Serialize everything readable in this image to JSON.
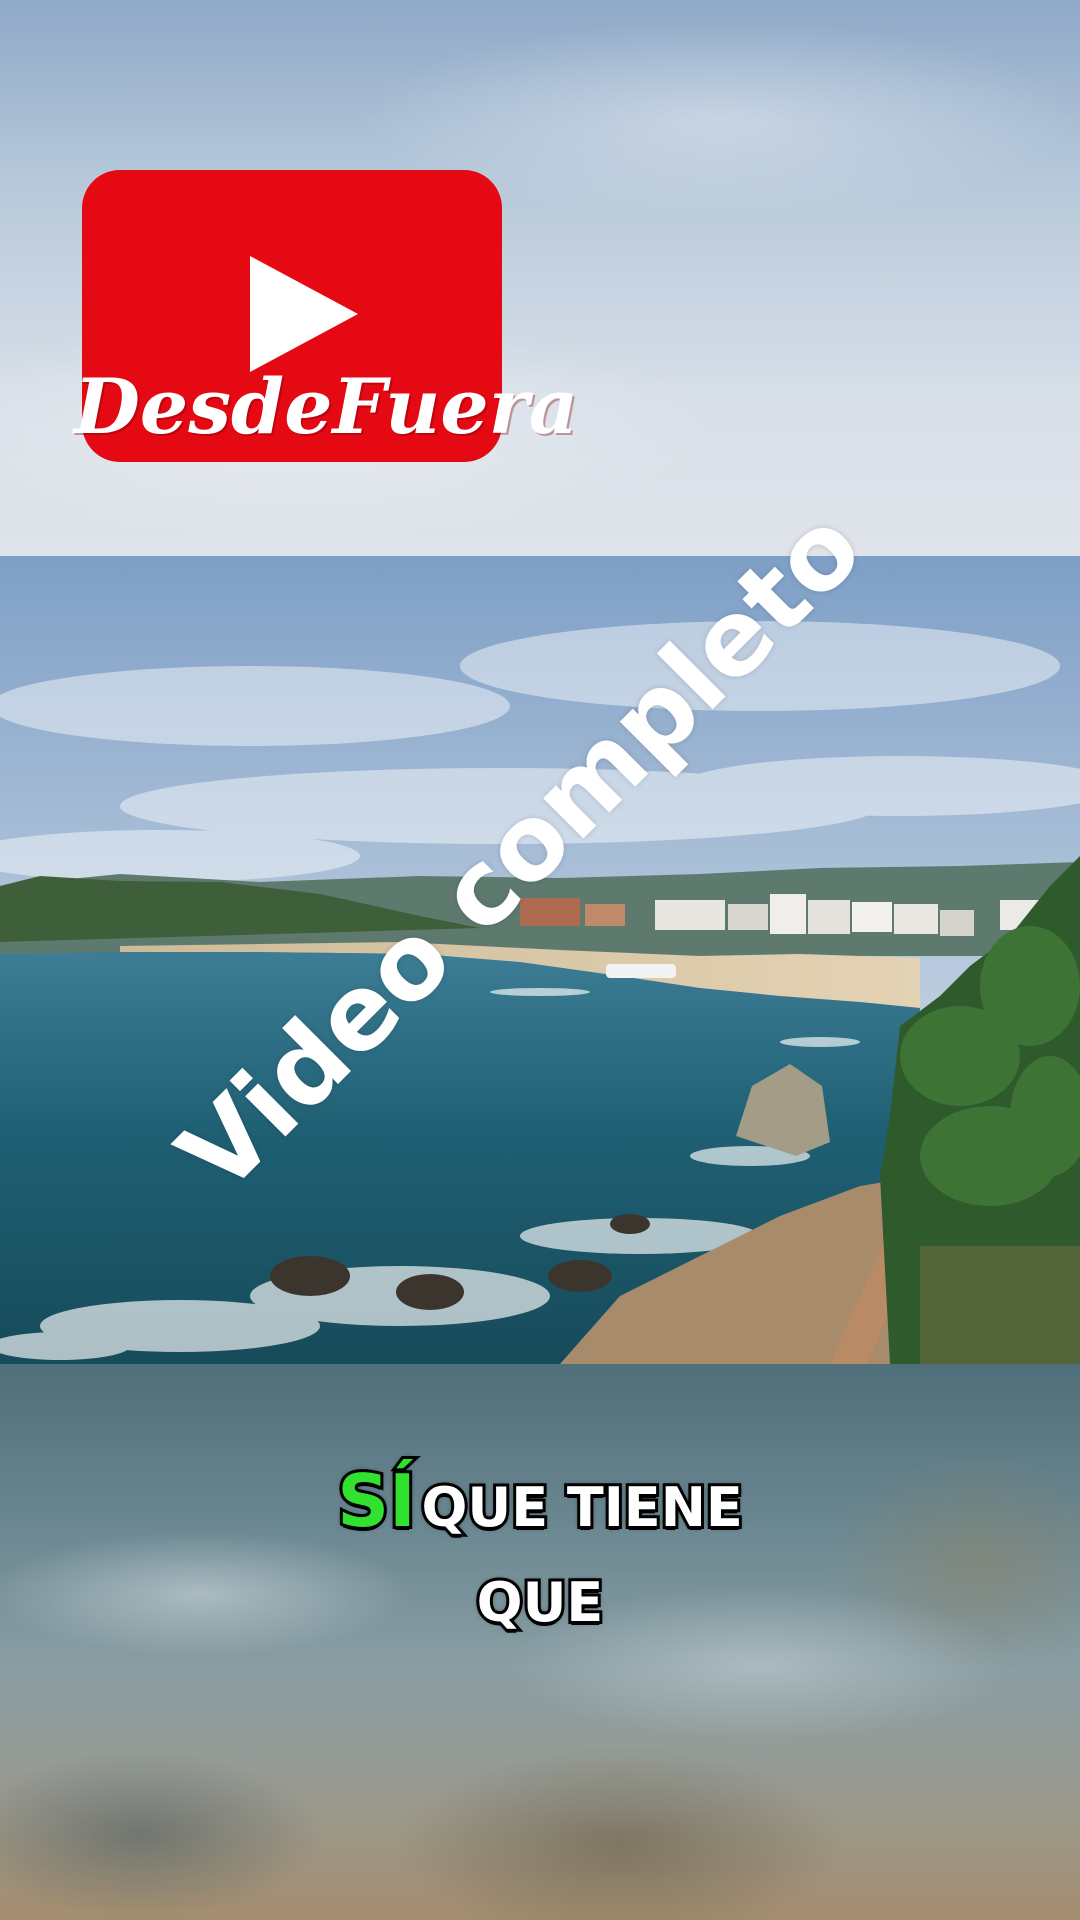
{
  "overlay": {
    "channel_name": "DesdeFuera",
    "watermark": "Video completo"
  },
  "captions": {
    "line1_highlight": "SÍ",
    "line1_rest": "QUE TIENE",
    "line2": "QUE"
  },
  "colors": {
    "logo_red": "#e50914",
    "caption_highlight": "#32e12f",
    "caption_text": "#ffffff"
  },
  "icons": {
    "logo": "youtube-play-icon"
  }
}
